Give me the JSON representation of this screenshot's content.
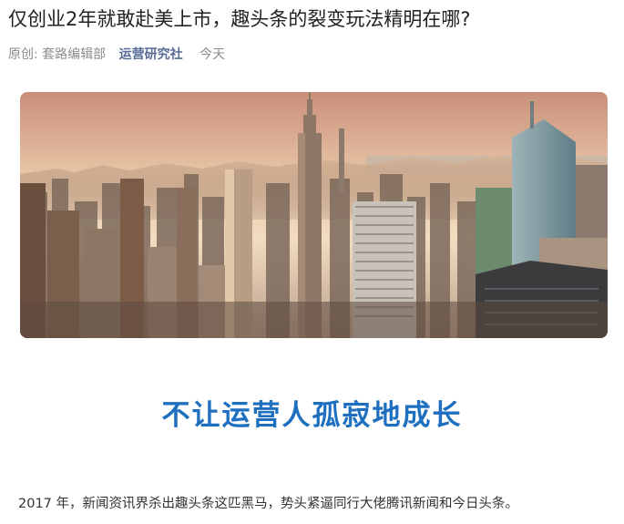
{
  "article": {
    "title": "仅创业2年就敢赴美上市，趣头条的裂变玩法精明在哪?",
    "meta": {
      "original_label": "原创:",
      "author": "套路编辑部",
      "account": "运营研究社",
      "date": "今天"
    },
    "hero_image": {
      "subject": "city-skyline-photo"
    },
    "banner_text": "不让运营人孤寂地成长",
    "paragraph": "2017 年，新闻资讯界杀出趣头条这匹黑马，势头紧逼同行大佬腾讯新闻和今日头条。"
  },
  "colors": {
    "title": "#222222",
    "meta": "#8c8c8c",
    "account_link": "#576b95",
    "banner": "#1e6fc0",
    "body": "#333333"
  }
}
